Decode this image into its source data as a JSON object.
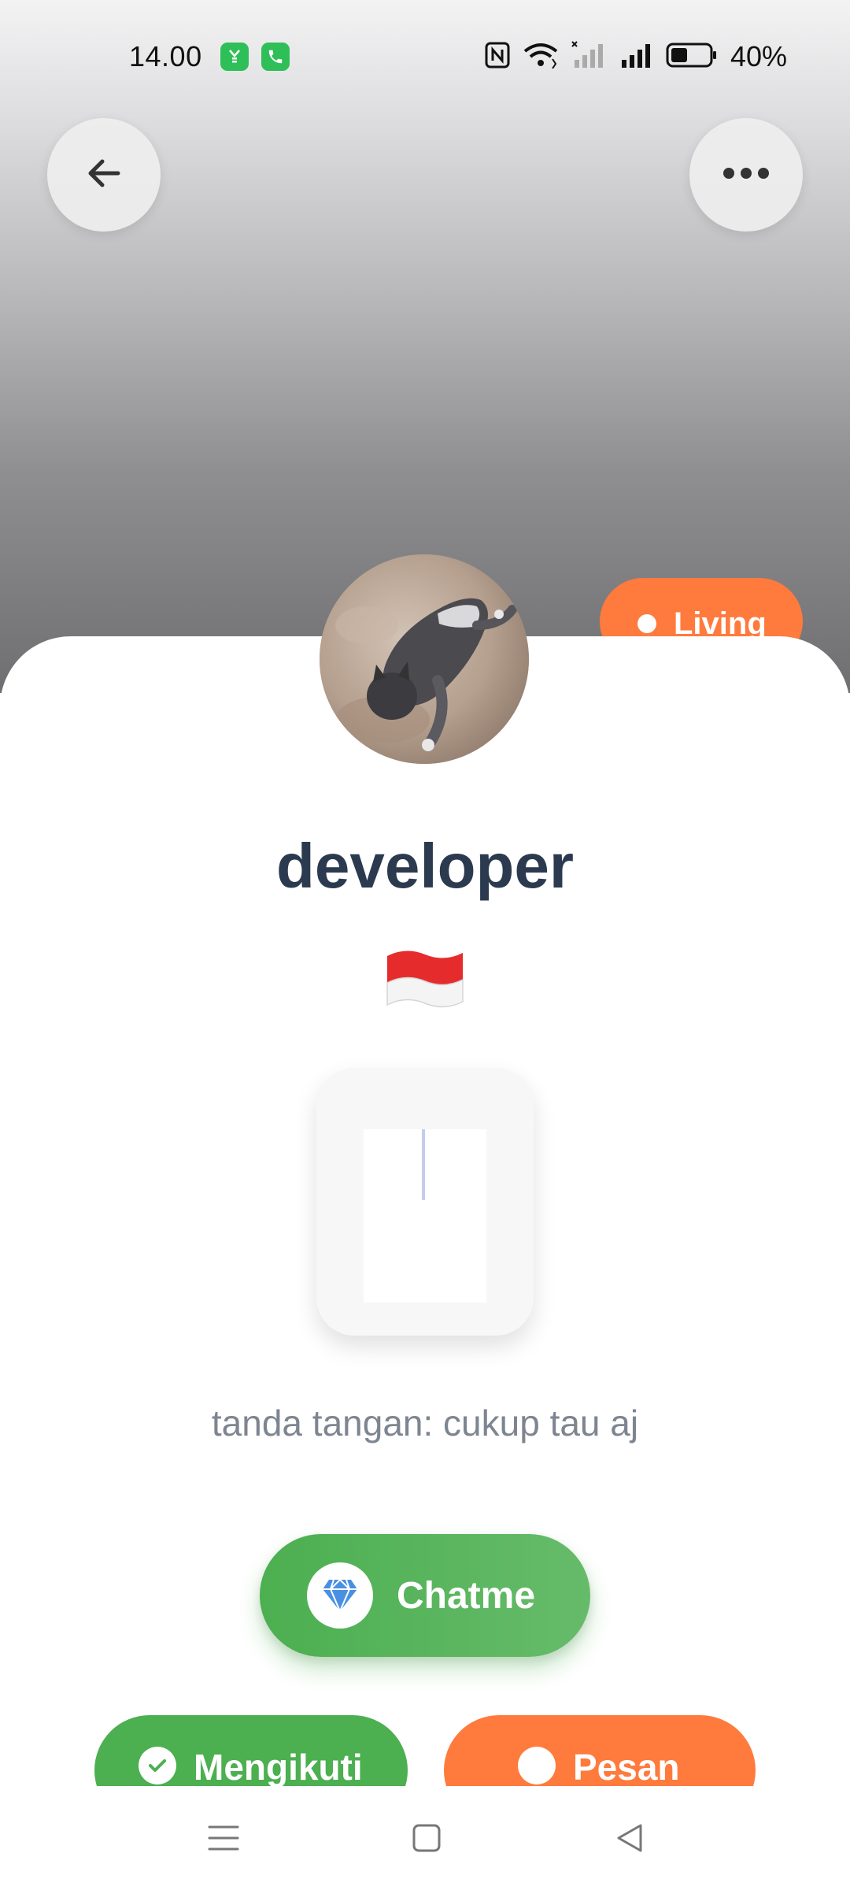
{
  "status_bar": {
    "time": "14.00",
    "battery_percent": "40%",
    "app_icons": [
      "app-notification-icon",
      "phone-call-icon"
    ],
    "system_icons": [
      "nfc-icon",
      "wifi-icon",
      "sim1-signal-icon",
      "sim2-signal-icon",
      "battery-icon"
    ]
  },
  "header": {
    "back_icon": "arrow-left-icon",
    "more_icon": "more-horizontal-icon",
    "living_label": "Living"
  },
  "profile": {
    "username": "developer",
    "flag": "indonesia-flag",
    "signature": "tanda tangan: cukup tau aj"
  },
  "actions": {
    "chatme_label": "Chatme",
    "chatme_icon": "diamond-icon",
    "follow_label": "Mengikuti",
    "follow_icon": "check-icon",
    "message_label": "Pesan"
  },
  "nav_bar": {
    "items": [
      "menu-icon",
      "home-icon",
      "back-triangle-icon"
    ]
  },
  "colors": {
    "accent_green": "#4caf50",
    "accent_orange": "#ff7a3d",
    "username": "#2b3a4f",
    "signature_text": "#7d8590"
  }
}
